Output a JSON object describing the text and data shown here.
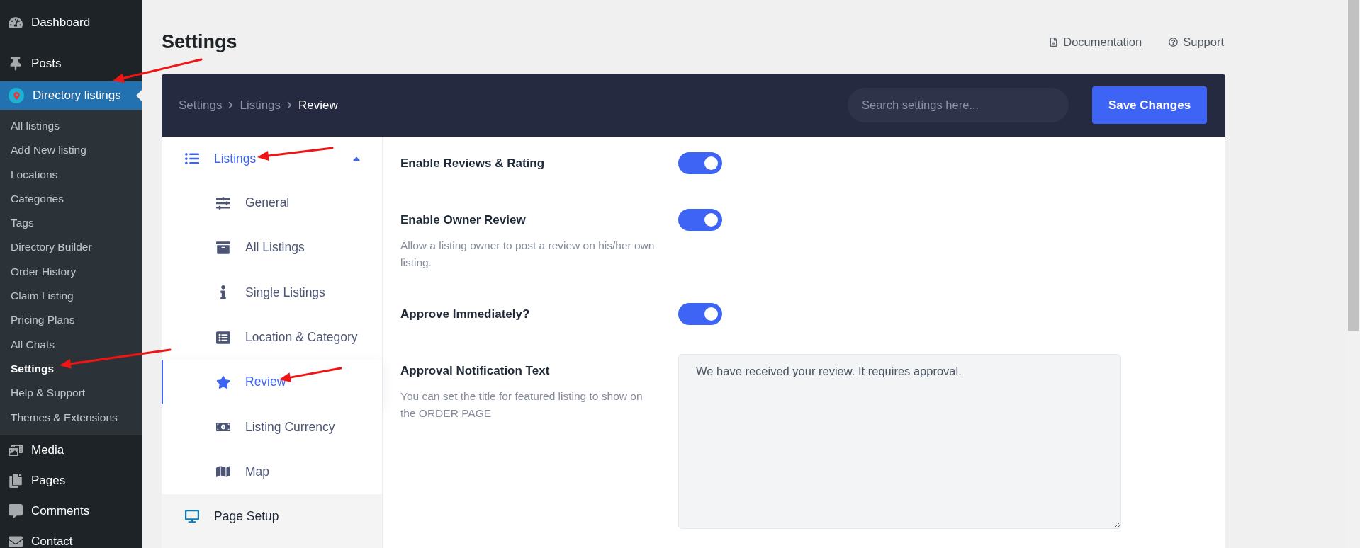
{
  "admin_menu": {
    "items": [
      {
        "label": "Dashboard",
        "selected": false
      },
      {
        "label": "Posts",
        "selected": false
      },
      {
        "label": "Directory listings",
        "selected": true,
        "children": [
          {
            "label": "All listings",
            "selected": false
          },
          {
            "label": "Add New listing",
            "selected": false
          },
          {
            "label": "Locations",
            "selected": false
          },
          {
            "label": "Categories",
            "selected": false
          },
          {
            "label": "Tags",
            "selected": false
          },
          {
            "label": "Directory Builder",
            "selected": false
          },
          {
            "label": "Order History",
            "selected": false
          },
          {
            "label": "Claim Listing",
            "selected": false
          },
          {
            "label": "Pricing Plans",
            "selected": false
          },
          {
            "label": "All Chats",
            "selected": false
          },
          {
            "label": "Settings",
            "selected": true
          },
          {
            "label": "Help & Support",
            "selected": false
          },
          {
            "label": "Themes & Extensions",
            "selected": false
          }
        ]
      },
      {
        "label": "Media",
        "selected": false
      },
      {
        "label": "Pages",
        "selected": false
      },
      {
        "label": "Comments",
        "selected": false
      },
      {
        "label": "Contact",
        "selected": false
      }
    ]
  },
  "page": {
    "title": "Settings",
    "links": [
      "Documentation",
      "Support"
    ]
  },
  "header": {
    "breadcrumb": [
      "Settings",
      "Listings",
      "Review"
    ],
    "search": {
      "placeholder": "Search settings here..."
    },
    "save_button": "Save Changes"
  },
  "settings_nav": [
    {
      "label": "Listings",
      "selected": true,
      "expanded": true,
      "children": [
        {
          "label": "General",
          "selected": false
        },
        {
          "label": "All Listings",
          "selected": false
        },
        {
          "label": "Single Listings",
          "selected": false
        },
        {
          "label": "Location & Category",
          "selected": false
        },
        {
          "label": "Review",
          "selected": true
        },
        {
          "label": "Listing Currency",
          "selected": false
        },
        {
          "label": "Map",
          "selected": false
        }
      ]
    },
    {
      "label": "Page Setup",
      "selected": false
    }
  ],
  "settings": [
    {
      "kind": "toggle",
      "label": "Enable Reviews & Rating",
      "on": true
    },
    {
      "kind": "toggle",
      "label": "Enable Owner Review",
      "description": "Allow a listing owner to post a review on his/her own listing.",
      "on": true
    },
    {
      "kind": "toggle",
      "label": "Approve Immediately?",
      "on": true
    },
    {
      "kind": "textarea",
      "label": "Approval Notification Text",
      "description": "You can set the title for featured listing to show on the ORDER PAGE",
      "value": "We have received your review. It requires approval."
    }
  ]
}
